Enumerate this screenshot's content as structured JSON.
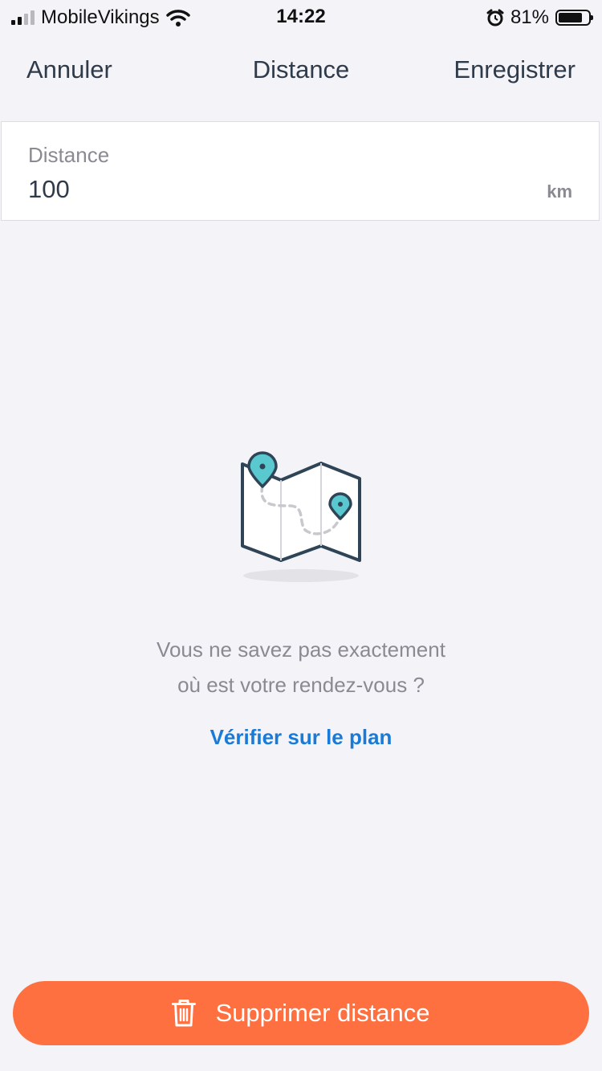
{
  "status_bar": {
    "carrier": "MobileVikings",
    "time": "14:22",
    "battery": "81%",
    "battery_level": 0.81,
    "signal_bars_active": 2,
    "signal_bars_total": 4
  },
  "nav": {
    "cancel_label": "Annuler",
    "title": "Distance",
    "save_label": "Enregistrer"
  },
  "distance_field": {
    "label": "Distance",
    "value": "100",
    "unit": "km"
  },
  "empty_state": {
    "line1": "Vous ne savez pas exactement",
    "line2": "où est votre rendez-vous ?",
    "link_label": "Vérifier sur le plan"
  },
  "delete_button": {
    "label": "Supprimer distance",
    "icon": "trash-icon"
  },
  "colors": {
    "accent": "#ff7040",
    "link": "#1a7ad8",
    "pin": "#5ac8cf",
    "text_dark": "#2f3b4a",
    "text_muted": "#8a8a93",
    "background": "#f4f4f8"
  }
}
